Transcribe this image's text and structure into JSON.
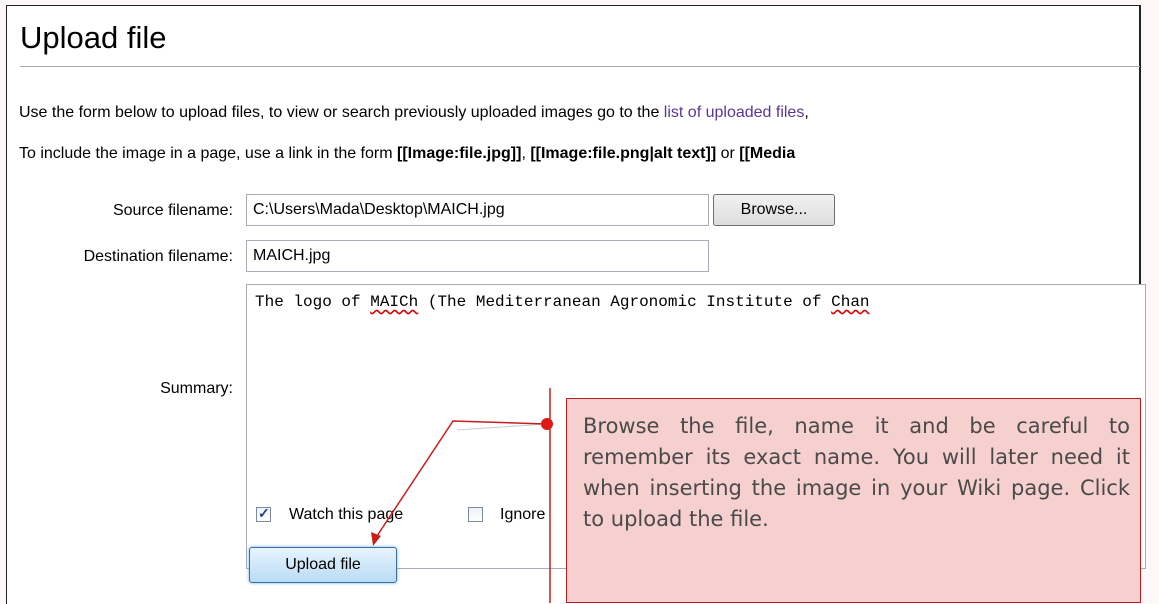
{
  "page": {
    "title": "Upload file",
    "intro_line1": {
      "text": "Use the form below to upload files, to view or search previously uploaded images go to the ",
      "link": "list of uploaded files",
      "after": ","
    },
    "intro_line2": {
      "text": "To include the image in a page, use a link in the form ",
      "code1": "[[Image:file.jpg]]",
      "sep1": ", ",
      "code2": "[[Image:file.png|alt text]]",
      "sep2": " or ",
      "code3": "[[Media"
    }
  },
  "form": {
    "source_label": "Source filename:",
    "source_value": "C:\\Users\\Mada\\Desktop\\MAICH.jpg",
    "browse_label": "Browse...",
    "destination_label": "Destination filename:",
    "destination_value": "MAICH.jpg",
    "summary_label": "Summary:",
    "summary_prefix": "The logo of ",
    "summary_word": "MAICh",
    "summary_middle": " (The Mediterranean Agronomic Institute of ",
    "summary_tail": "Chan",
    "watch_label": "Watch this page",
    "watch_checked": true,
    "ignore_label": "Ignore",
    "ignore_checked": false,
    "upload_label": "Upload file"
  },
  "callout": {
    "text": "Browse the file, name it and be careful to remember its exact name. You will later need it when inserting the image in your Wiki page. Click to upload the file.",
    "color": "#c81e1e"
  }
}
